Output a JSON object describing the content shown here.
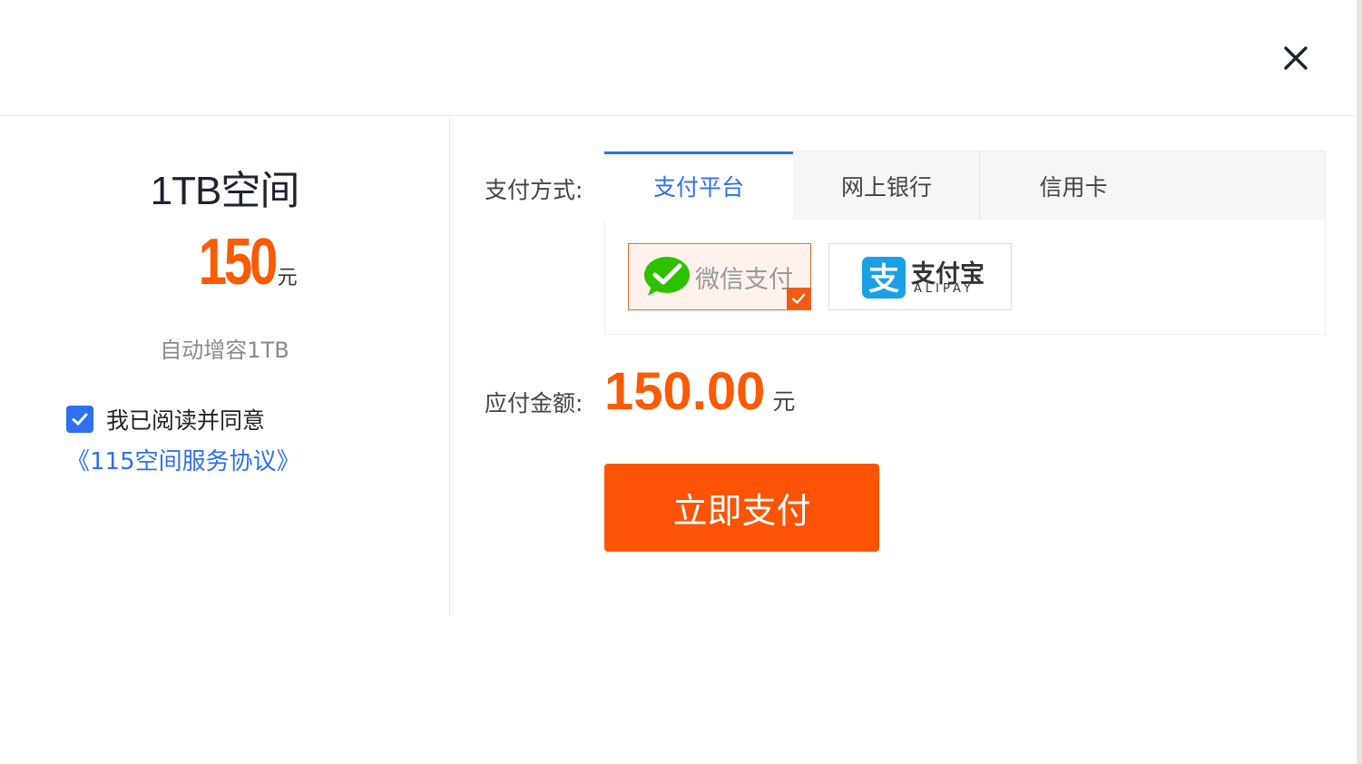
{
  "plan": {
    "title": "1TB空间",
    "price": "150",
    "price_unit": "元",
    "description": "自动增容1TB"
  },
  "agreement": {
    "checked": true,
    "label": "我已阅读并同意",
    "link_text": "《115空间服务协议》"
  },
  "payment": {
    "method_label": "支付方式:",
    "tabs": [
      {
        "label": "支付平台",
        "active": true
      },
      {
        "label": "网上银行",
        "active": false
      },
      {
        "label": "信用卡",
        "active": false
      }
    ],
    "methods": [
      {
        "name": "微信支付",
        "icon": "wechat-pay-icon",
        "selected": true
      },
      {
        "name": "支付宝",
        "subtitle": "ALIPAY",
        "icon": "alipay-icon",
        "selected": false
      }
    ],
    "amount_label": "应付金额:",
    "amount": "150.00",
    "amount_unit": "元",
    "pay_button": "立即支付"
  },
  "colors": {
    "accent_orange": "#fc5a04",
    "link_blue": "#2f6ff0",
    "wechat_green": "#2dc100",
    "alipay_blue": "#1aa1e5"
  }
}
